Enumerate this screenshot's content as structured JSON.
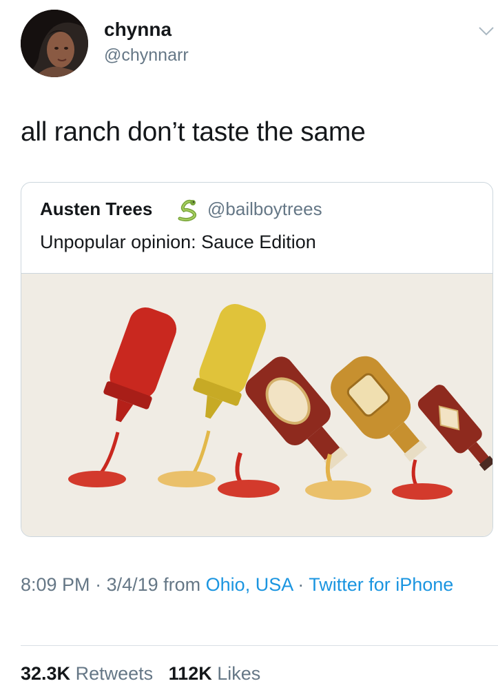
{
  "author": {
    "display_name": "chynna",
    "handle": "@chynnarr"
  },
  "tweet": {
    "text": "all ranch don’t taste the same"
  },
  "quoted_tweet": {
    "display_name": "Austen Trees",
    "emoji": "snake-emoji",
    "handle": "@bailboytrees",
    "text": "Unpopular opinion: Sauce Edition",
    "image": "sauce-bottles-illustration"
  },
  "meta": {
    "time": "8:09 PM",
    "sep1": " · ",
    "date": "3/4/19",
    "from_label": " from ",
    "location": "Ohio, USA",
    "sep2": " · ",
    "source": "Twitter for iPhone"
  },
  "stats": {
    "retweets_count": "32.3K",
    "retweets_label": "Retweets",
    "likes_count": "112K",
    "likes_label": "Likes"
  },
  "colors": {
    "link": "#1b95e0",
    "secondary_text": "#657786",
    "primary_text": "#14171a"
  }
}
